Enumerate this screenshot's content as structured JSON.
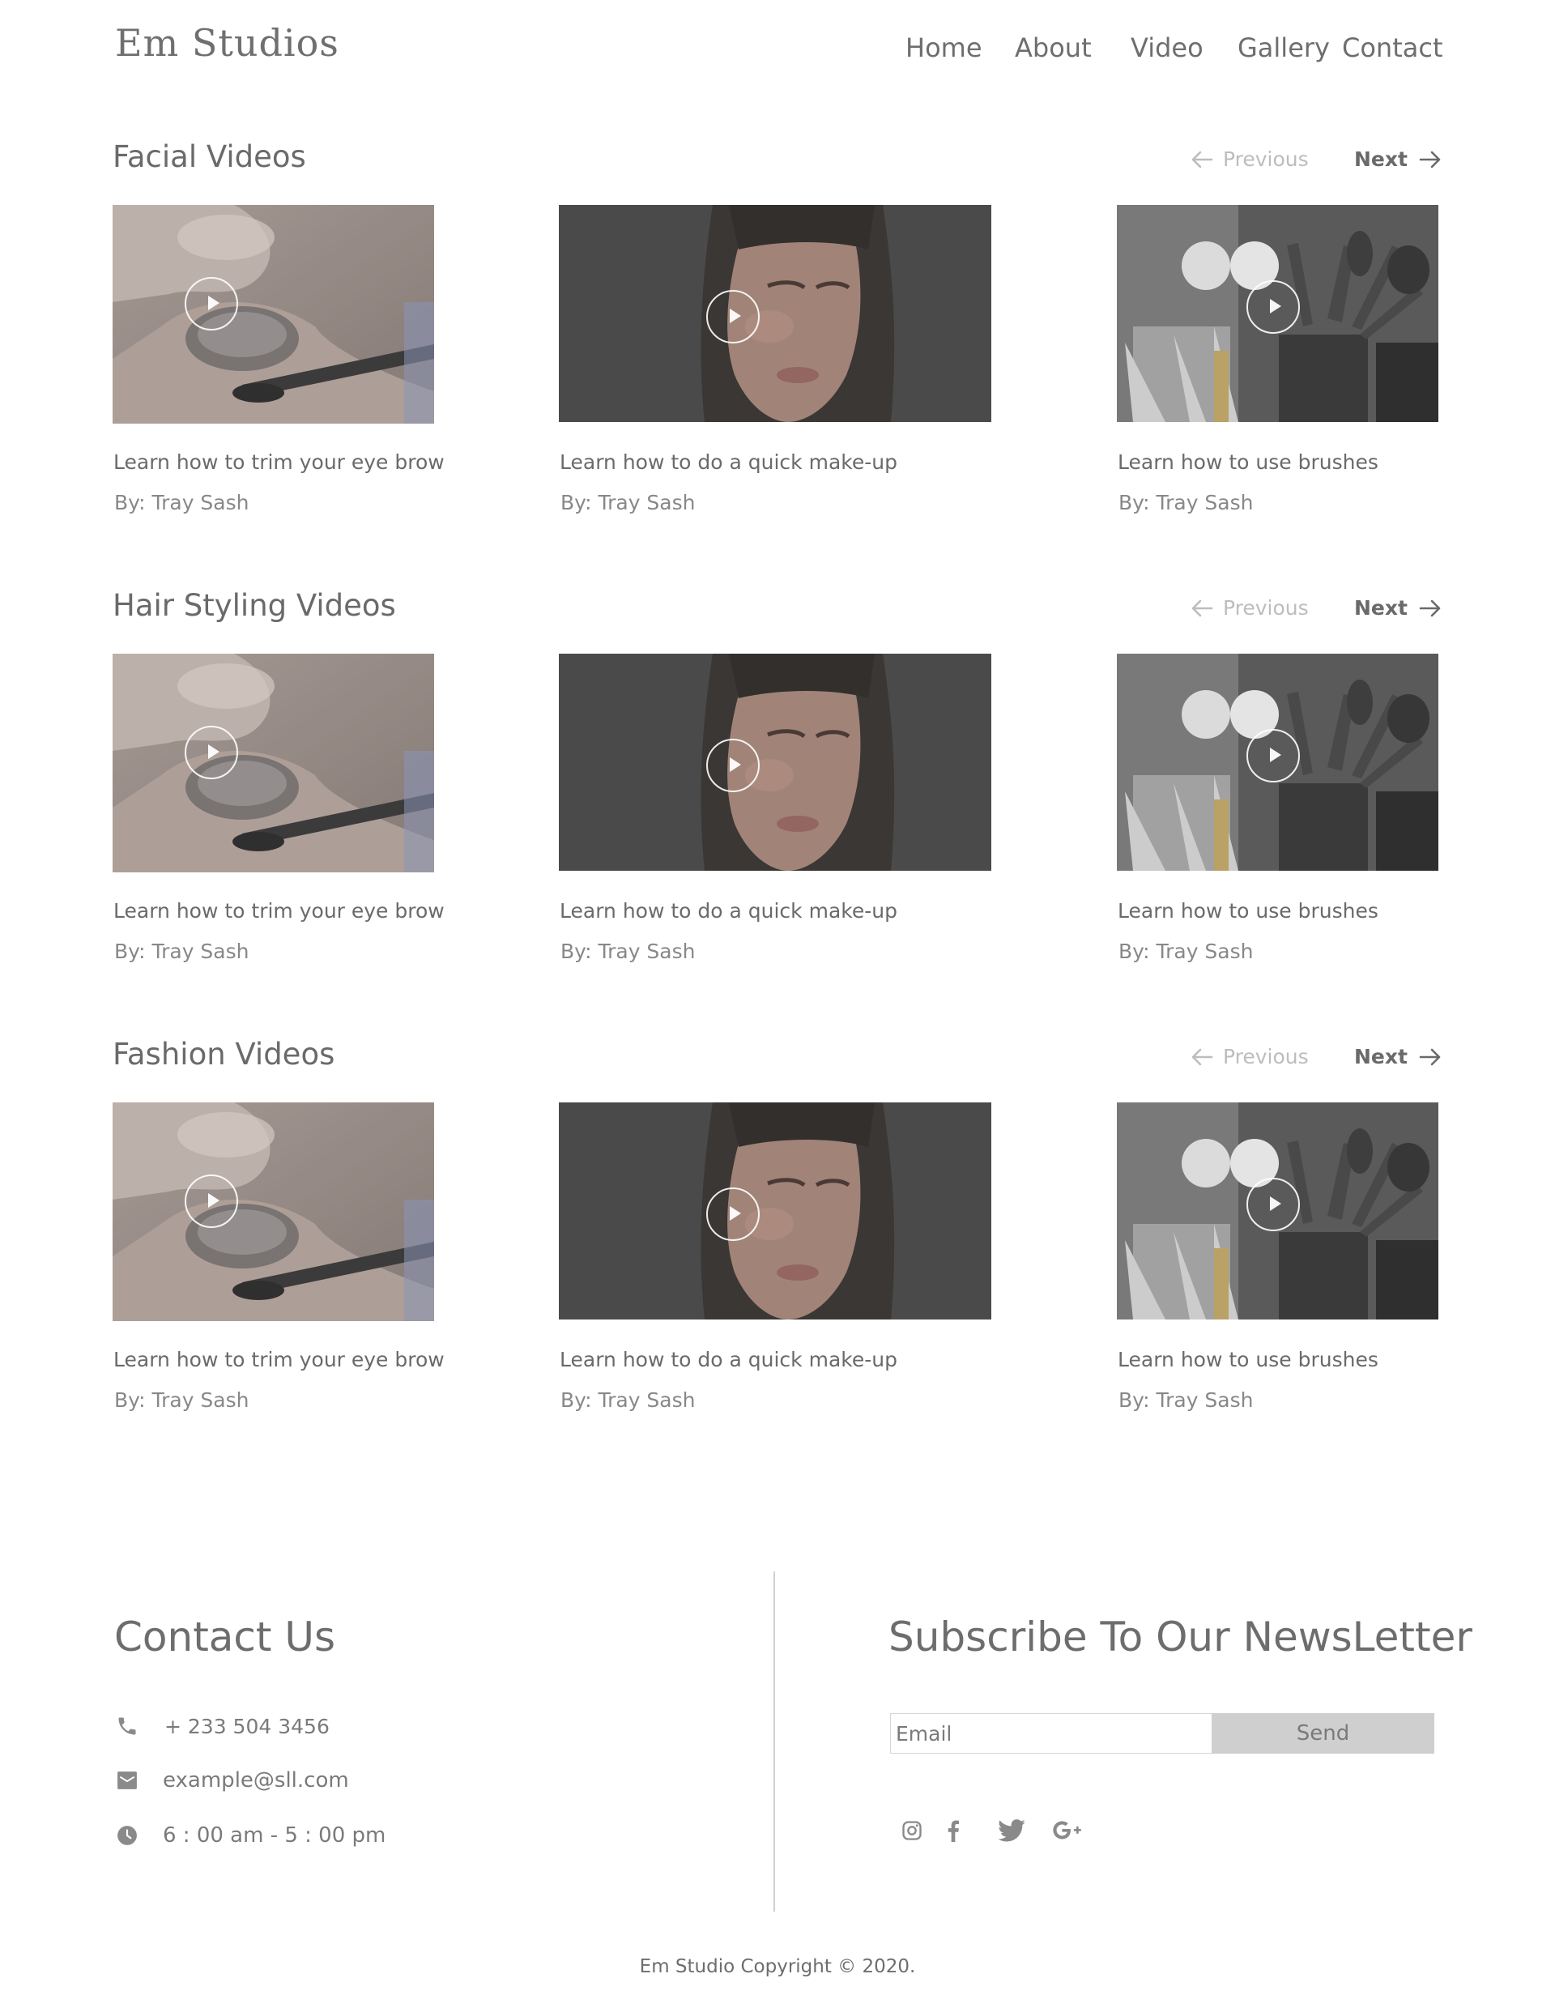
{
  "header": {
    "logo": "Em Studios",
    "nav": [
      {
        "label": "Home"
      },
      {
        "label": "About"
      },
      {
        "label": "Video"
      },
      {
        "label": "Gallery"
      },
      {
        "label": "Contact"
      }
    ]
  },
  "sections": [
    {
      "title": "Facial Videos",
      "prev_label": "Previous",
      "next_label": "Next",
      "cards": [
        {
          "title": "Learn how to trim your eye brow",
          "author": "By: Tray Sash"
        },
        {
          "title": "Learn how to do a quick make-up",
          "author": "By: Tray Sash"
        },
        {
          "title": "Learn how to use brushes",
          "author": "By: Tray Sash"
        }
      ]
    },
    {
      "title": "Hair Styling Videos",
      "prev_label": "Previous",
      "next_label": "Next",
      "cards": [
        {
          "title": "Learn how to trim your eye brow",
          "author": "By: Tray Sash"
        },
        {
          "title": "Learn how to do a quick make-up",
          "author": "By: Tray Sash"
        },
        {
          "title": "Learn how to use brushes",
          "author": "By: Tray Sash"
        }
      ]
    },
    {
      "title": "Fashion Videos",
      "prev_label": "Previous",
      "next_label": "Next",
      "cards": [
        {
          "title": "Learn how to trim your eye brow",
          "author": "By: Tray Sash"
        },
        {
          "title": "Learn how to do a quick make-up",
          "author": "By: Tray Sash"
        },
        {
          "title": "Learn how to use brushes",
          "author": "By: Tray Sash"
        }
      ]
    }
  ],
  "contact": {
    "heading": "Contact Us",
    "phone": "+ 233 504 3456",
    "email": "example@sll.com",
    "hours": "6 : 00 am - 5 : 00 pm"
  },
  "newsletter": {
    "heading": "Subscribe To Our NewsLetter",
    "email_placeholder": "Email",
    "send_label": "Send"
  },
  "social": [
    "instagram-icon",
    "facebook-icon",
    "twitter-icon",
    "google-plus-icon"
  ],
  "copyright": "Em Studio Copyright © 2020.",
  "colors": {
    "text": "#6b6b6b",
    "muted": "#bdbdbd",
    "button_bg": "#cfcfcf",
    "divider": "#d0d0d0"
  }
}
